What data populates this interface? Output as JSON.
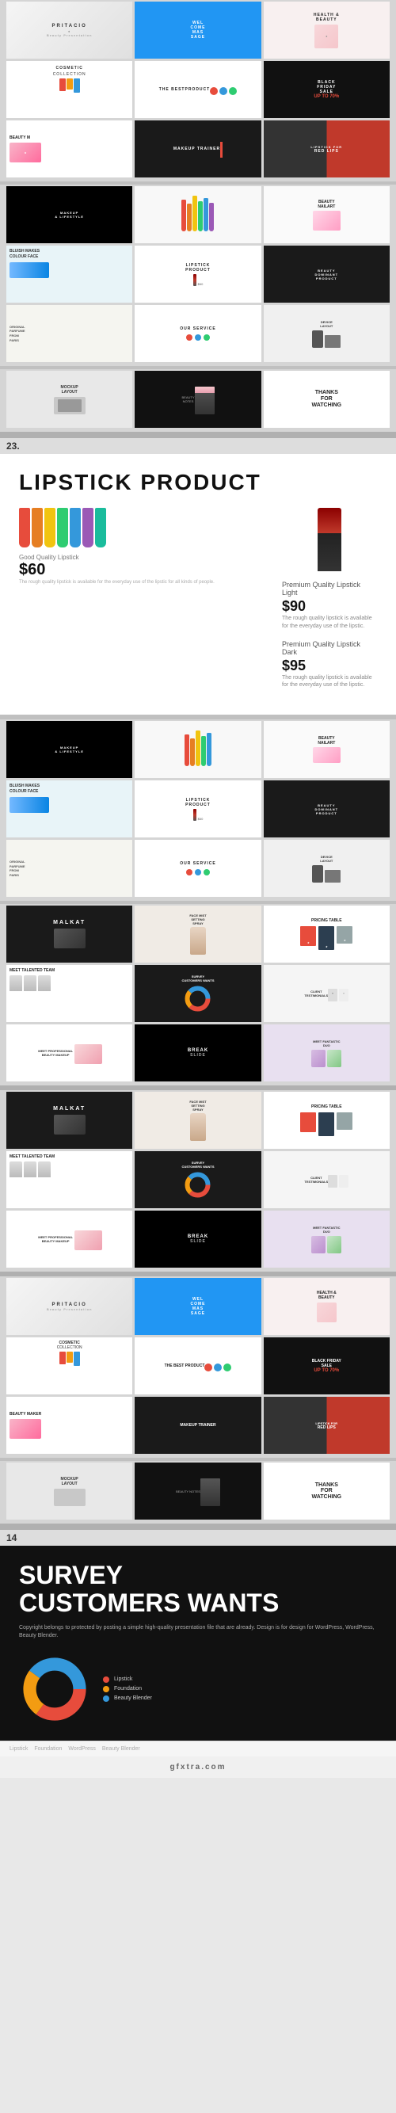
{
  "site": {
    "logo": "gfxtra.com",
    "watermark": "Copyright belongs to protected by posting a simple high-quality presentation file that are already."
  },
  "sections": [
    {
      "id": "group1",
      "rows": [
        [
          {
            "type": "pritacio",
            "label": "PRITACIO",
            "sub": "Beauty Presentation"
          },
          {
            "type": "welcome",
            "label": "WELCOME MESSAGE"
          },
          {
            "type": "health",
            "label": "HEALTH & BEAUTY"
          }
        ],
        [
          {
            "type": "cosmetic",
            "label": "COSMETIC COLLECTION"
          },
          {
            "type": "best-product",
            "label": "THE BEST PRODUCT"
          },
          {
            "type": "black-friday",
            "label": "BLACK FRIDAY SALE UP TO 70%"
          }
        ],
        [
          {
            "type": "beauty-m",
            "label": "BEAUTY M"
          },
          {
            "type": "makeup-trainer",
            "label": "MAKEUP TRAINER"
          },
          {
            "type": "lipstick-red",
            "label": "LIPSTICK FOR RED LIPS"
          }
        ]
      ]
    },
    {
      "id": "group2",
      "rows": [
        [
          {
            "type": "makeup-lifestyle",
            "label": "MAKEUP & LIFESTYLE"
          },
          {
            "type": "colorful",
            "label": ""
          },
          {
            "type": "beauty-nailart",
            "label": "BEAUTY NAILART"
          }
        ],
        [
          {
            "type": "bluish",
            "label": "BLUISH MAKES COLOUR FACE"
          },
          {
            "type": "lipstick-product",
            "label": "LIPSTICK PRODUCT"
          },
          {
            "type": "beauty-dominant",
            "label": "BEAUTY DOMINANT PRODUCT"
          }
        ],
        [
          {
            "type": "original-parfume",
            "label": "ORIGINAL PARFUME FROM PARIS"
          },
          {
            "type": "our-service",
            "label": "OUR SERVICE"
          },
          {
            "type": "device-layout",
            "label": "DEVICE LAYOUT"
          }
        ]
      ]
    },
    {
      "id": "group3",
      "rows": [
        [
          {
            "type": "mockup",
            "label": "MOCKUP LAYOUT"
          },
          {
            "type": "beauty-notes",
            "label": "BEAUTY NOTES"
          },
          {
            "type": "thanks",
            "label": "THANKS FOR WATCHING"
          }
        ]
      ]
    }
  ],
  "featured_lipstick": {
    "section_num": "23.",
    "title": "LIPSTICK PRODUCT",
    "product1_label": "Premium Quality Lipstick Light",
    "product1_price": "$90",
    "product1_desc": "The rough quality lipstick is available for the everyday use of the lipstic.",
    "product2_label": "Premium Quality Lipstick Dark",
    "product2_price": "$95",
    "product2_desc": "The rough quality lipstick is available for the everyday use of the lipstic.",
    "cheap_label": "Good Quality Lipstick",
    "cheap_price": "$60",
    "cheap_desc": "The rough quality lipstick is available for the everyday use of the lipstic for all kinds of people.",
    "crayon_colors": [
      "#e74c3c",
      "#e67e22",
      "#f1c40f",
      "#2ecc71",
      "#3498db",
      "#9b59b6",
      "#1abc9c"
    ]
  },
  "featured_survey": {
    "section_num": "14",
    "title": "SURVEY\nCUSTOMERS WANTS",
    "desc": "Copyright belongs to protected by posting a simple high-quality presentation file that are already. Design is for design for WordPress, WordPress, Beauty Blender.",
    "donut": {
      "segments": [
        {
          "label": "Lipstick",
          "color": "#e74c3c",
          "percent": 35
        },
        {
          "label": "Foundation",
          "color": "#f39c12",
          "percent": 25
        },
        {
          "label": "Beauty Blender",
          "color": "#3498db",
          "percent": 40
        }
      ]
    },
    "footer_links": [
      "Lipstick",
      "Foundation",
      "WordPress",
      "Beauty Blender"
    ]
  },
  "section2_rows": [
    [
      {
        "type": "makeup-lifestyle",
        "label": "MAKEUP & LIFESTYLE"
      },
      {
        "type": "colorful",
        "label": ""
      },
      {
        "type": "beauty-nailart",
        "label": "BEAUTY NAILART"
      }
    ],
    [
      {
        "type": "bluish",
        "label": "BLUISH MAKES COLOUR FACE"
      },
      {
        "type": "lipstick-product",
        "label": "LIPSTICK PRODUCT"
      },
      {
        "type": "beauty-dominant",
        "label": "BEAUTY DOMINANT PRODUCT"
      }
    ],
    [
      {
        "type": "original-parfume",
        "label": "ORIGINAL PARFUME FROM PARIS"
      },
      {
        "type": "our-service",
        "label": "OUR SERVICE"
      },
      {
        "type": "device-layout",
        "label": "DEVICE LAYOUT"
      }
    ],
    [
      {
        "type": "malkat",
        "label": "MALKAT"
      },
      {
        "type": "face-mist",
        "label": "FACE MIST SETTING SPRAY"
      },
      {
        "type": "pricing",
        "label": "PRICING TABLE"
      }
    ],
    [
      {
        "type": "meet-team",
        "label": "MEET TALENTED TEAM"
      },
      {
        "type": "survey-sm",
        "label": "SURVEY CUSTOMERS WANTS"
      },
      {
        "type": "testimonials",
        "label": "CLIENT TESTIMONIALS"
      }
    ],
    [
      {
        "type": "pro-beauty",
        "label": "MEET PROFESSIONAL BEAUTY MAKEUP"
      },
      {
        "type": "break",
        "label": "BREAK SLIDE"
      },
      {
        "type": "fantastic",
        "label": "MEET FANTASTIC DUO"
      }
    ]
  ],
  "section3_rows": [
    [
      {
        "type": "malkat",
        "label": "MALKAT"
      },
      {
        "type": "face-mist",
        "label": "FACE MIST SETTING SPRAY"
      },
      {
        "type": "pricing",
        "label": "PRICING TABLE"
      }
    ],
    [
      {
        "type": "meet-team",
        "label": "MEET TALENTED TEAM"
      },
      {
        "type": "survey-sm",
        "label": "SURVEY CUSTOMERS WANTS"
      },
      {
        "type": "testimonials",
        "label": "CLIENT TESTIMONIALS"
      }
    ],
    [
      {
        "type": "pro-beauty",
        "label": "MEET PROFESSIONAL BEAUTY MAKEUP"
      },
      {
        "type": "break",
        "label": "BREAK SLIDE"
      },
      {
        "type": "fantastic",
        "label": "MEET FANTASTIC DUO"
      }
    ]
  ],
  "section4_rows": [
    [
      {
        "type": "pritacio",
        "label": "PRITACIO"
      },
      {
        "type": "welcome",
        "label": "WELCOME MESSAGE"
      },
      {
        "type": "health",
        "label": "HEALTH & BEAUTY"
      }
    ],
    [
      {
        "type": "cosmetic",
        "label": "COSMETIC COLLECTION"
      },
      {
        "type": "best-product",
        "label": "THE BEST PRODUCT"
      },
      {
        "type": "black-friday",
        "label": "BLACK FRIDAY SALE UP TO 70%"
      }
    ],
    [
      {
        "type": "beauty-m",
        "label": "BEAUTY MAKER"
      },
      {
        "type": "makeup-trainer",
        "label": "MAKEUP TRAINER"
      },
      {
        "type": "lipstick-red",
        "label": "LIPSTICK FOR RED LIPS"
      }
    ]
  ],
  "section5_rows": [
    [
      {
        "type": "mockup",
        "label": "MOCKUP LAYOUT"
      },
      {
        "type": "beauty-notes",
        "label": "BEAUTY NOTES"
      },
      {
        "type": "thanks",
        "label": "THANKS FOR WATCHING"
      }
    ]
  ]
}
